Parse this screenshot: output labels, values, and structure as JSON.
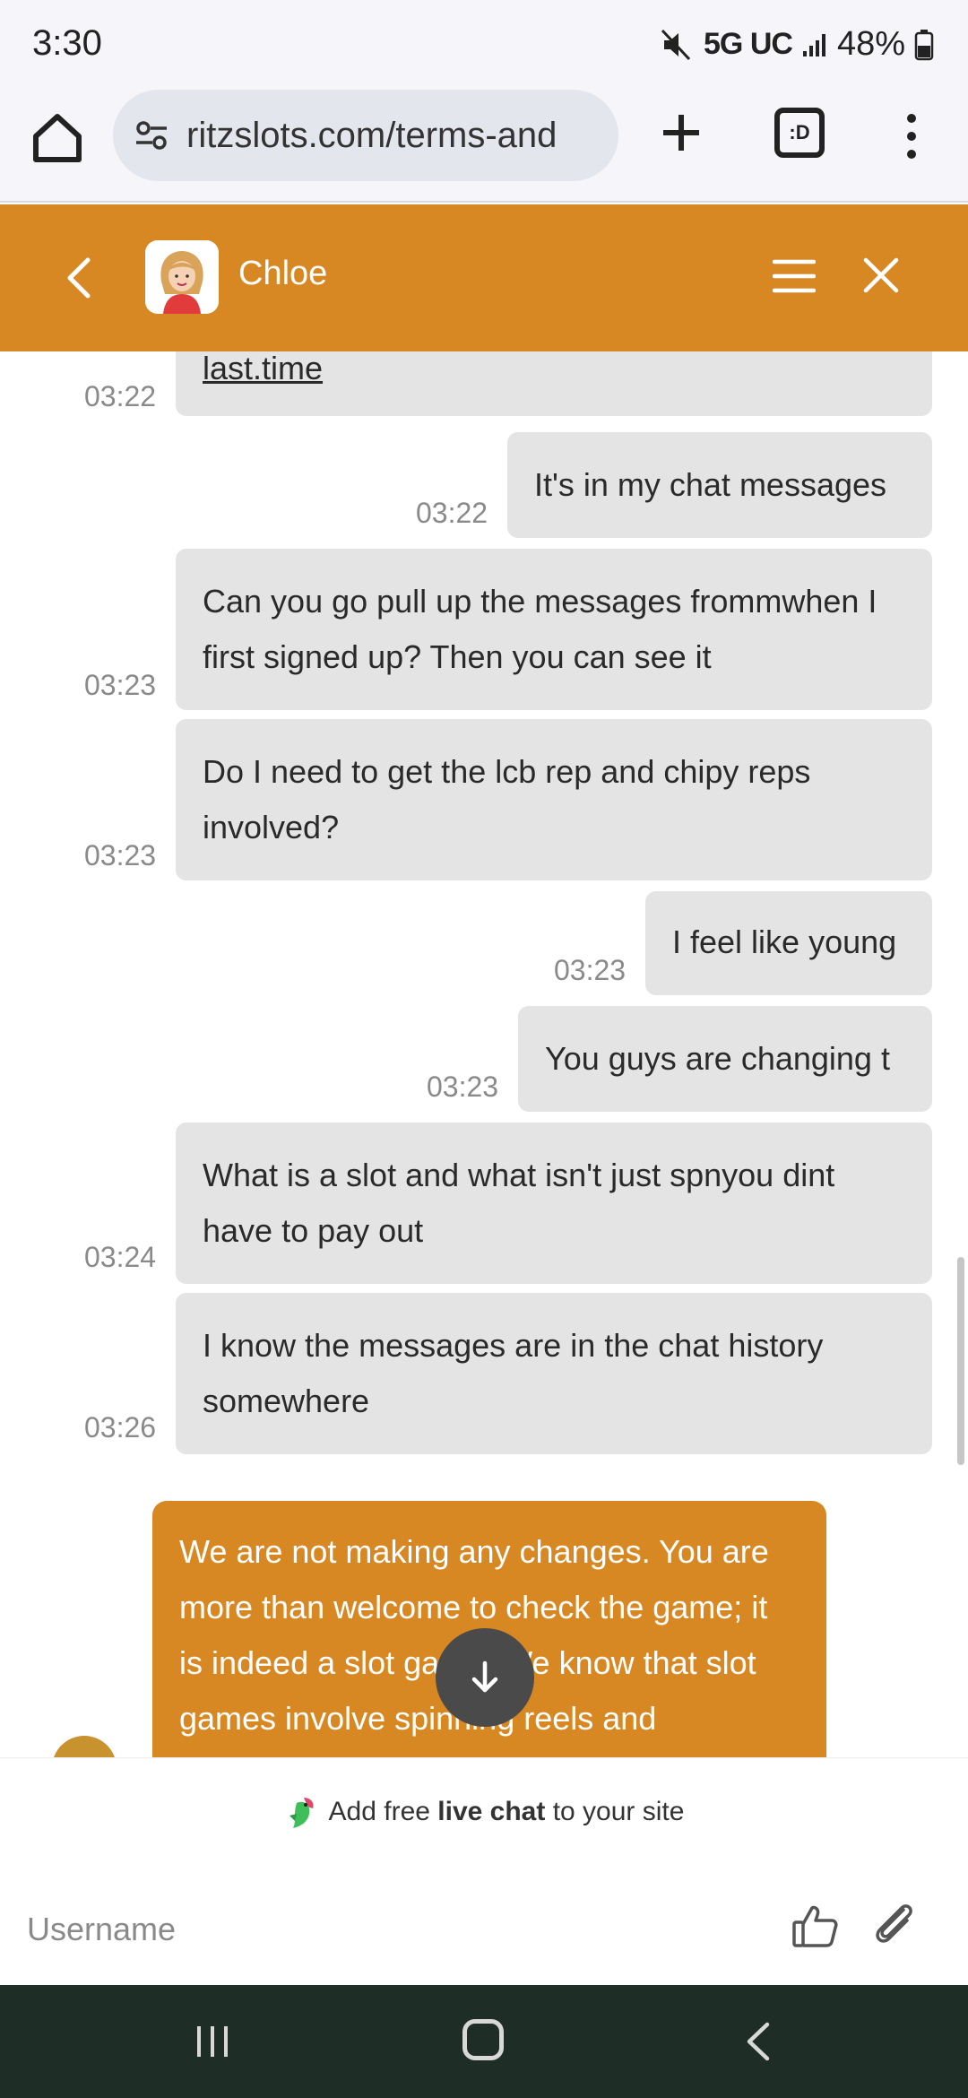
{
  "status_bar": {
    "time": "3:30",
    "network": "5G UC",
    "battery": "48%",
    "icons": [
      "mute-icon",
      "signal-icon",
      "battery-icon"
    ]
  },
  "browser": {
    "url": "ritzslots.com/terms-and",
    "tab_badge": ":D",
    "icons": [
      "home-icon",
      "site-settings-icon",
      "new-tab-icon",
      "tabs-icon",
      "more-vert-icon"
    ]
  },
  "chat": {
    "agent_name": "Chloe",
    "colors": {
      "accent": "#d88823",
      "bubble": "#e4e4e4"
    },
    "messages": [
      {
        "text": "last.time",
        "time": "03:22"
      },
      {
        "text": "It's in my chat messages",
        "time": "03:22"
      },
      {
        "text": "Can you go pull up the messages frommwhen I first signed up? Then you can see it",
        "time": "03:23"
      },
      {
        "text": "Do I need to get the lcb rep and chipy reps involved?",
        "time": "03:23"
      },
      {
        "text": "I feel like young",
        "time": "03:23"
      },
      {
        "text": "You guys are changing t",
        "time": "03:23"
      },
      {
        "text": "What is a slot and what isn't just spnyou dint have to pay out",
        "time": "03:24"
      },
      {
        "text": "I know the messages are in the chat history somewhere",
        "time": "03:26"
      }
    ],
    "agent_message": "We are not making any changes. You are more than welcome to check the game; it is indeed a slot game. We know that slot games involve spinning reels and"
  },
  "footer": {
    "powered_prefix": "Add free ",
    "powered_bold": "live chat",
    "powered_suffix": " to your site",
    "input_placeholder": "Username"
  }
}
